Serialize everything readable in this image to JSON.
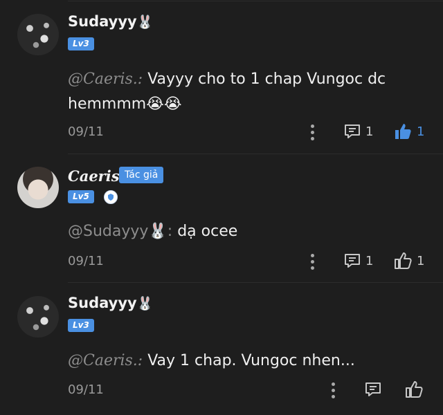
{
  "comments": [
    {
      "author": "Sudayyy",
      "author_emoji": "🐰",
      "level": "Lv3",
      "mention": "@Caeris.:",
      "text": "Vayyy cho to 1 chap Vungoc dc hemmmm😭😭",
      "date": "09/11",
      "reply_count": "1",
      "like_count": "1",
      "liked": true
    },
    {
      "author": "Caeris.",
      "author_tag": "Tác giả",
      "level": "Lv5",
      "mention": "@Sudayyy🐰:",
      "text": "dạ ocee",
      "date": "09/11",
      "reply_count": "1",
      "like_count": "1",
      "liked": false
    },
    {
      "author": "Sudayyy",
      "author_emoji": "🐰",
      "level": "Lv3",
      "mention": "@Caeris.:",
      "text": "Vay 1 chap. Vungoc nhen...",
      "date": "09/11",
      "reply_count": "",
      "like_count": "",
      "liked": false
    }
  ],
  "colors": {
    "background": "#1e1e1e",
    "accent": "#4a90e2",
    "muted": "#9a9a9a"
  },
  "icons": [
    "more-vertical-icon",
    "reply-icon",
    "like-icon",
    "shield-icon"
  ]
}
